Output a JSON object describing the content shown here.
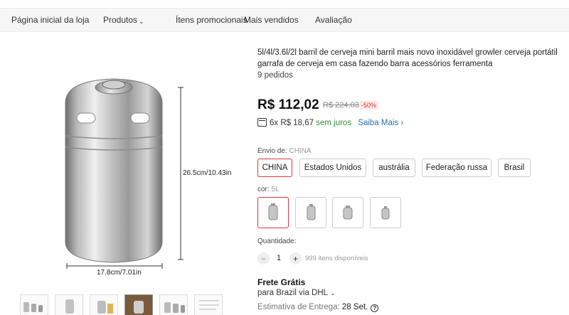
{
  "nav": {
    "items": [
      {
        "label": "Página inicial da loja"
      },
      {
        "label": "Produtos"
      },
      {
        "label": "Ítens promocionais"
      },
      {
        "label": "Mais vendidos"
      },
      {
        "label": "Avaliação"
      }
    ]
  },
  "gallery": {
    "dim_height": "26.5cm/10.43in",
    "dim_width": "17.8cm/7.01in",
    "thumbnail_count": 6,
    "active_thumbnail": 4
  },
  "product": {
    "title": "5l/4l/3.6l/2l barril de cerveja mini barril mais novo inoxidável growler cerveja portátil garrafa de cerveja em casa fazendo barra acessórios ferramenta",
    "orders": "9 pedidos",
    "price": "R$ 112,02",
    "old_price": "R$ 224,03",
    "discount": "-50%",
    "installments": "6x R$ 18,67",
    "interest": "sem juros",
    "learn_more": "Saiba Mais"
  },
  "shipping_from": {
    "label": "Envio de:",
    "value": "CHINA",
    "options": [
      "CHINA",
      "Estados Unidos",
      "austrália",
      "Federação russa",
      "Brasil"
    ],
    "selected": "CHINA"
  },
  "color": {
    "label": "cor:",
    "value": "5L",
    "option_count": 4,
    "selected_index": 0
  },
  "quantity": {
    "label": "Quantidade:",
    "minus": "−",
    "value": "1",
    "plus": "+",
    "available": "999 itens disponíveis"
  },
  "delivery": {
    "free_shipping": "Frete Grátis",
    "via": "para Brazil via DHL",
    "estimate_label": "Estimativa de Entrega:",
    "estimate_date": "28 Set."
  },
  "colors": {
    "accent": "#e0363a",
    "green": "#2f8f3a",
    "link": "#2a6fb0"
  }
}
